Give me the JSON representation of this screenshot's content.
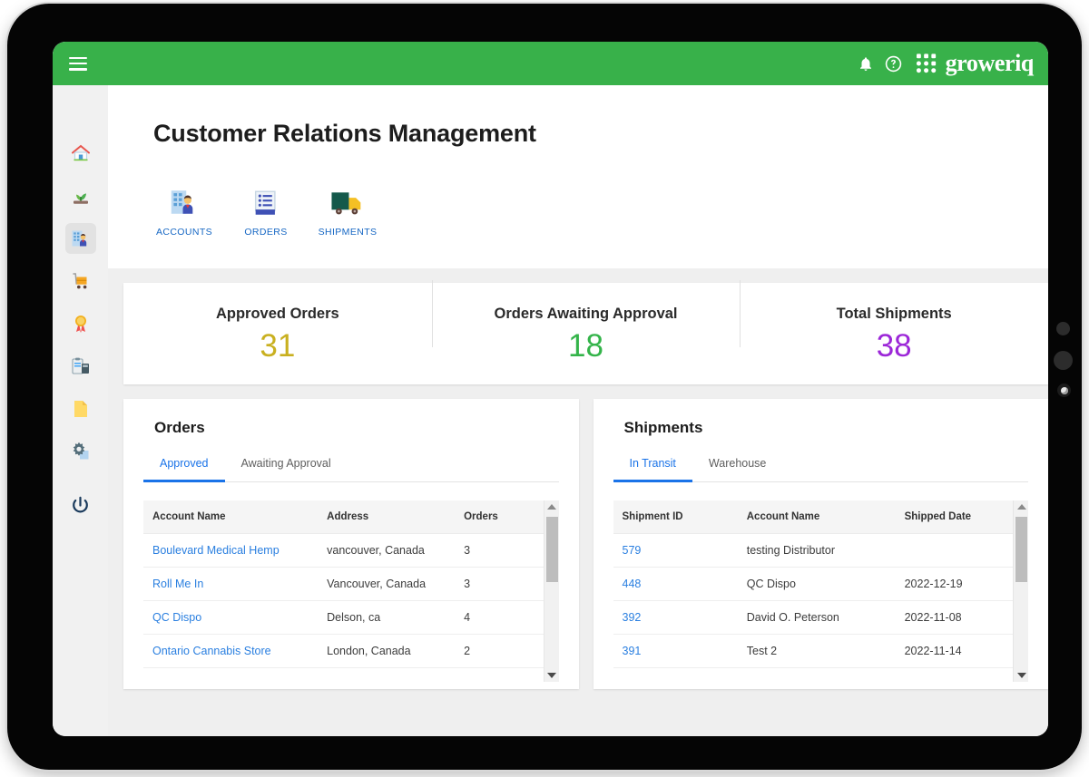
{
  "brand": {
    "name": "groweriq",
    "green": "#38b14a",
    "logo_icon": "dot-grid-logo-icon"
  },
  "topbar": {
    "menu_icon": "hamburger-menu-icon",
    "notification_icon": "bell-icon",
    "help_icon": "question-circle-icon"
  },
  "sidebar": {
    "items": [
      {
        "icon": "home-icon",
        "active": false
      },
      {
        "icon": "seedling-plant-icon",
        "active": false
      },
      {
        "icon": "accounts-building-person-icon",
        "active": true
      },
      {
        "icon": "inventory-cart-icon",
        "active": false
      },
      {
        "icon": "quality-award-ribbon-icon",
        "active": false
      },
      {
        "icon": "clipboard-reports-icon",
        "active": false
      },
      {
        "icon": "documents-file-icon",
        "active": false
      },
      {
        "icon": "settings-gear-icon",
        "active": false
      },
      {
        "icon": "power-logout-icon",
        "active": false
      }
    ]
  },
  "page": {
    "title": "Customer Relations Management",
    "shortcuts": [
      {
        "label": "ACCOUNTS",
        "icon": "accounts-building-person-icon"
      },
      {
        "label": "ORDERS",
        "icon": "orders-receipt-list-icon"
      },
      {
        "label": "SHIPMENTS",
        "icon": "shipments-truck-icon"
      }
    ]
  },
  "stats": [
    {
      "label": "Approved Orders",
      "value": "31",
      "color": "#c9b020"
    },
    {
      "label": "Orders Awaiting Approval",
      "value": "18",
      "color": "#34b44a"
    },
    {
      "label": "Total Shipments",
      "value": "38",
      "color": "#9c27d8"
    }
  ],
  "orders_panel": {
    "title": "Orders",
    "tabs": [
      {
        "label": "Approved",
        "active": true
      },
      {
        "label": "Awaiting Approval",
        "active": false
      }
    ],
    "columns": [
      "Account Name",
      "Address",
      "Orders"
    ],
    "rows": [
      {
        "account_name": "Boulevard Medical Hemp",
        "address": "vancouver, Canada",
        "orders": "3"
      },
      {
        "account_name": "Roll Me In",
        "address": "Vancouver, Canada",
        "orders": "3"
      },
      {
        "account_name": "QC Dispo",
        "address": "Delson, ca",
        "orders": "4"
      },
      {
        "account_name": "Ontario Cannabis Store",
        "address": "London, Canada",
        "orders": "2"
      }
    ]
  },
  "shipments_panel": {
    "title": "Shipments",
    "tabs": [
      {
        "label": "In Transit",
        "active": true
      },
      {
        "label": "Warehouse",
        "active": false
      }
    ],
    "columns": [
      "Shipment ID",
      "Account Name",
      "Shipped Date"
    ],
    "rows": [
      {
        "shipment_id": "579",
        "account_name": "testing Distributor",
        "shipped_date": ""
      },
      {
        "shipment_id": "448",
        "account_name": "QC Dispo",
        "shipped_date": "2022-12-19"
      },
      {
        "shipment_id": "392",
        "account_name": "David O. Peterson",
        "shipped_date": "2022-11-08"
      },
      {
        "shipment_id": "391",
        "account_name": "Test 2",
        "shipped_date": "2022-11-14"
      }
    ]
  }
}
